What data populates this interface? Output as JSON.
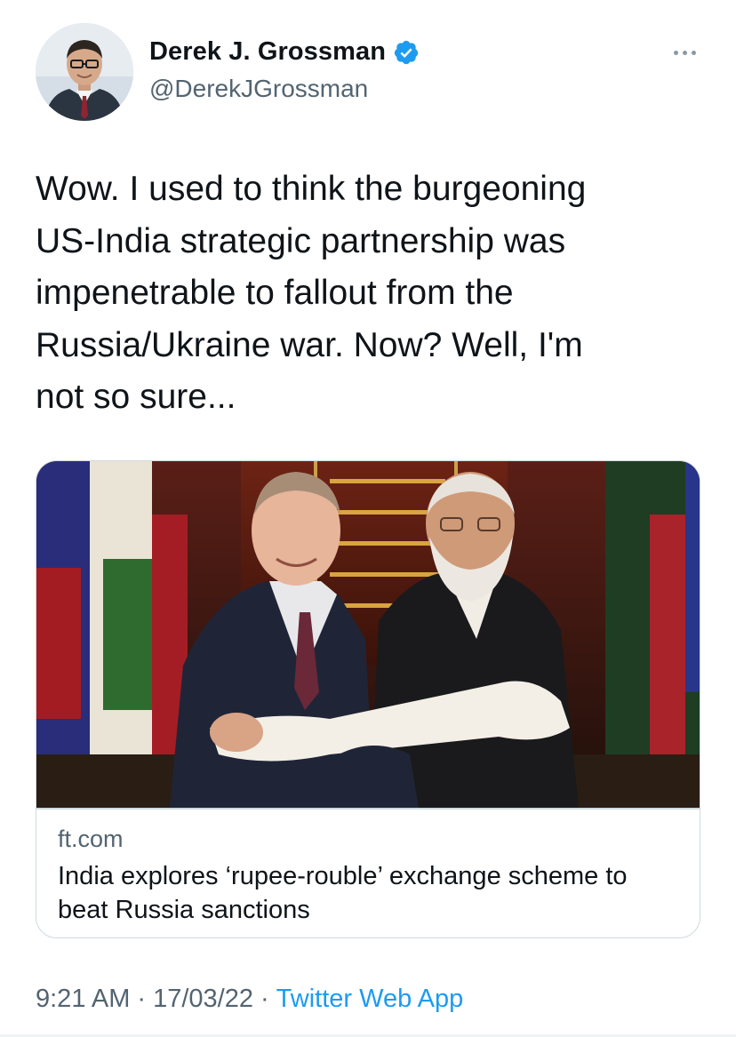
{
  "author": {
    "display_name": "Derek J. Grossman",
    "handle": "@DerekJGrossman",
    "verified": true
  },
  "icons": {
    "verified": "verified-badge-icon",
    "more": "more-options-icon"
  },
  "tweet": {
    "text": "Wow. I used to think the burgeoning\nUS-India strategic partnership was\nimpenetrable to fallout from the\nRussia/Ukraine war. Now? Well, I'm\nnot so sure..."
  },
  "card": {
    "domain": "ft.com",
    "title": "India explores ‘rupee-rouble’ exchange scheme to beat Russia sanctions"
  },
  "meta": {
    "time": "9:21 AM",
    "separator": "·",
    "date": "17/03/22",
    "source": "Twitter Web App"
  },
  "colors": {
    "accent": "#1d9bf0",
    "text": "#0f1419",
    "secondary": "#536471",
    "border": "#cfd9de"
  }
}
